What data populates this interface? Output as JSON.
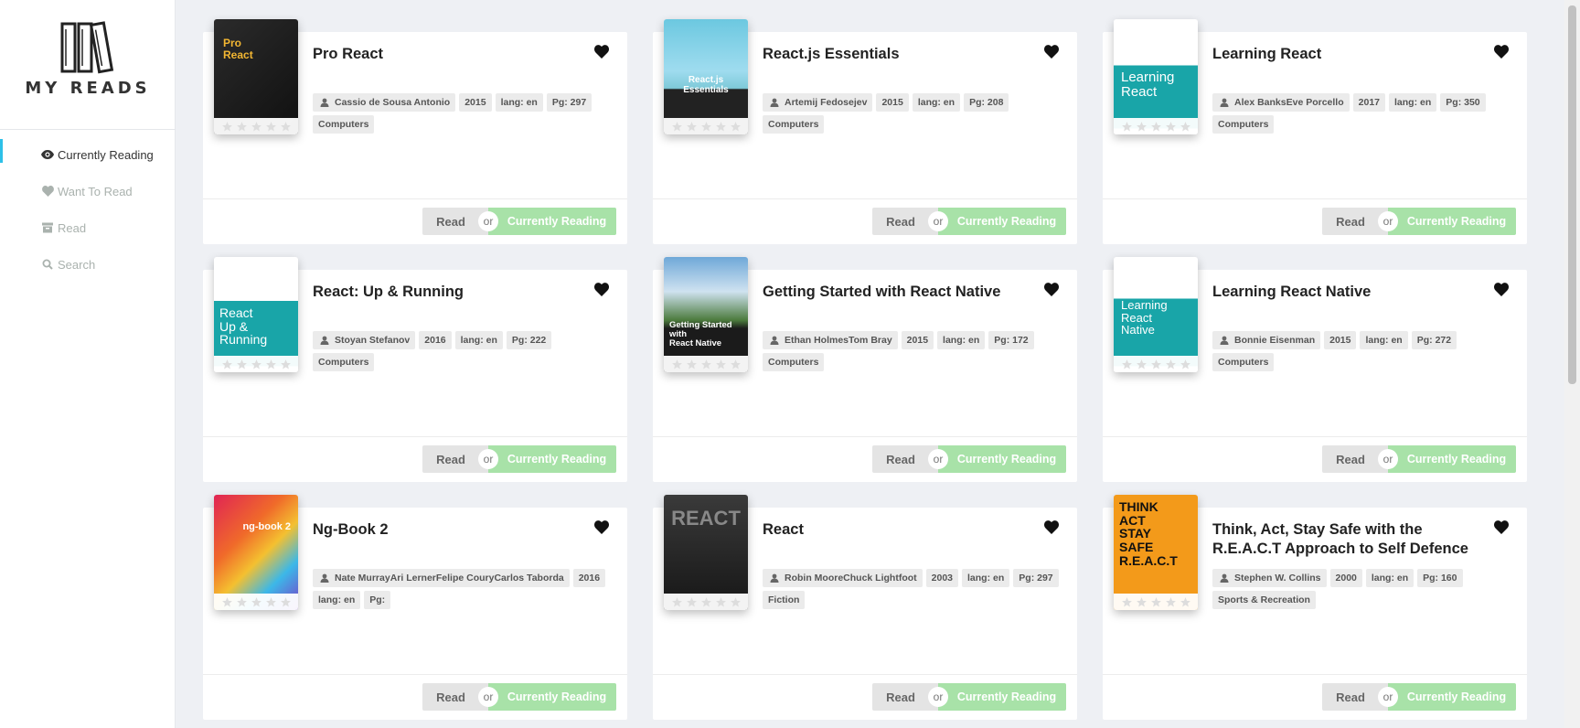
{
  "app": {
    "logo_text": "MY READS"
  },
  "nav": [
    {
      "label": "Currently Reading",
      "icon": "eye-icon",
      "active": true
    },
    {
      "label": "Want To Read",
      "icon": "heart-icon",
      "active": false
    },
    {
      "label": "Read",
      "icon": "archive-icon",
      "active": false
    },
    {
      "label": "Search",
      "icon": "search-icon",
      "active": false
    }
  ],
  "actions": {
    "read_label": "Read",
    "or_label": "or",
    "current_label": "Currently Reading"
  },
  "colors": {
    "accent": "#2dc0e8",
    "current_button": "#a8e2a8",
    "read_button": "#e4e4e4"
  },
  "books": [
    {
      "title": "Pro React",
      "tags": [
        "Cassio de Sousa Antonio",
        "2015",
        "lang: en",
        "Pg: 297",
        "Computers"
      ]
    },
    {
      "title": "React.js Essentials",
      "tags": [
        "Artemij Fedosejev",
        "2015",
        "lang: en",
        "Pg: 208",
        "Computers"
      ]
    },
    {
      "title": "Learning React",
      "tags": [
        "Alex BanksEve Porcello",
        "2017",
        "lang: en",
        "Pg: 350",
        "Computers"
      ]
    },
    {
      "title": "React: Up & Running",
      "tags": [
        "Stoyan Stefanov",
        "2016",
        "lang: en",
        "Pg: 222",
        "Computers"
      ]
    },
    {
      "title": "Getting Started with React Native",
      "tags": [
        "Ethan HolmesTom Bray",
        "2015",
        "lang: en",
        "Pg: 172",
        "Computers"
      ]
    },
    {
      "title": "Learning React Native",
      "tags": [
        "Bonnie Eisenman",
        "2015",
        "lang: en",
        "Pg: 272",
        "Computers"
      ]
    },
    {
      "title": "Ng-Book 2",
      "tags": [
        "Nate MurrayAri LernerFelipe CouryCarlos Taborda",
        "2016",
        "lang: en",
        "Pg:"
      ]
    },
    {
      "title": "React",
      "tags": [
        "Robin MooreChuck Lightfoot",
        "2003",
        "lang: en",
        "Pg: 297",
        "Fiction"
      ]
    },
    {
      "title": "Think, Act, Stay Safe with the R.E.A.C.T Approach to Self Defence",
      "tags": [
        "Stephen W. Collins",
        "2000",
        "lang: en",
        "Pg: 160",
        "Sports & Recreation"
      ]
    }
  ],
  "covers": [
    {
      "lines": [
        "Pro",
        "React"
      ]
    },
    {
      "lines": [
        "React.js Essentials"
      ]
    },
    {
      "lines": [
        "Learning",
        "React"
      ]
    },
    {
      "lines": [
        "React",
        "Up & Running"
      ]
    },
    {
      "lines": [
        "Getting Started with",
        "React Native"
      ]
    },
    {
      "lines": [
        "Learning",
        "React",
        "Native"
      ]
    },
    {
      "lines": [
        "ng-book 2"
      ]
    },
    {
      "lines": [
        "REACT"
      ]
    },
    {
      "lines": [
        "THINK",
        "ACT",
        "STAY",
        "SAFE",
        "R.E.A.C.T"
      ]
    }
  ]
}
